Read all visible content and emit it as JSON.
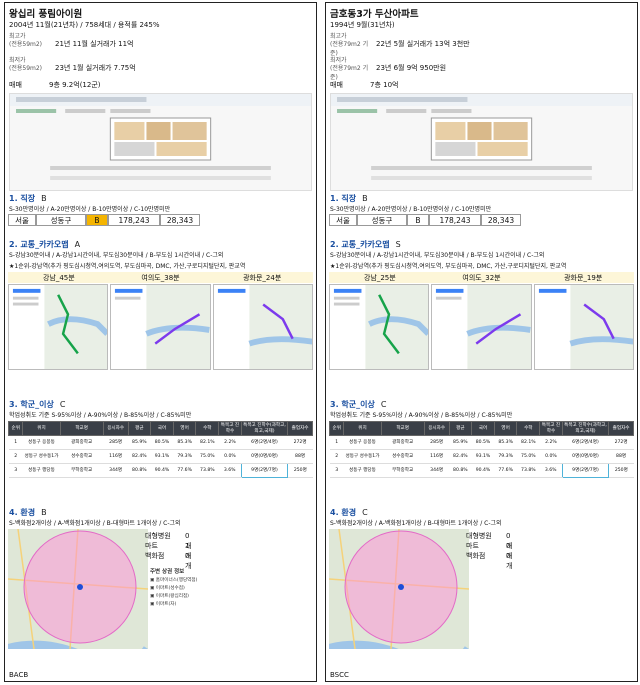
{
  "panels": [
    {
      "name": "왕십리 풍림아이원",
      "built": "2004년 11월(21년차) / 758세대 / 용적률 245%",
      "max_price_label": "최고가",
      "max_price_type": "(전용59m2)",
      "max_price": "21년 11월 실거래가 11억",
      "min_price_label": "최저가",
      "min_price_type": "(전용59m2)",
      "min_price": "23년 1월 실거래가 7.75억",
      "sale_label": "매매",
      "sale_value": "9층 9.2억(12군)",
      "job": {
        "heading": "1. 직장",
        "grade": "B",
        "criteria": "S-30만명이상 / A-20만명이상 / B-10만명이상 / C-10만명미만",
        "city": "서울",
        "district": "성동구",
        "district_grade": "B",
        "v1": "178,243",
        "v2": "28,343"
      },
      "transport": {
        "heading": "2. 교통_카카오맵",
        "grade": "A",
        "criteria": "S-강남30분이내 / A-강남1시간이내, 부도심30분이내 / B-부도심 1시간이내 / C-그외",
        "note": "★1순위-강남역(추가 핑도심시청역,여의도역, 부도심마곡, DMC, 가산,구로디지털단지, 판교역",
        "routes": [
          "강남_45분",
          "여의도_38분",
          "광화문_24분"
        ]
      },
      "school": {
        "heading": "3. 학군_이상",
        "grade": "C",
        "criteria": "학업성취도 기준 S-95%이상 / A-90%이상 / B-85%이상 / C-85%미만",
        "headers": [
          "순위",
          "위치",
          "학교명",
          "응시자수",
          "평균",
          "국어",
          "영어",
          "수학",
          "특목고 진학수",
          "특목고 진학수(과학고,외고,국제)",
          "졸업자수"
        ],
        "rows": [
          [
            "1",
            "성동구 응봉동",
            "광희중학교",
            "285명",
            "85.9%",
            "80.5%",
            "85.3%",
            "82.1%",
            "2.2%",
            "6명(2명/4명)",
            "272명"
          ],
          [
            "2",
            "성동구 성수동1가",
            "성수중학교",
            "116명",
            "82.4%",
            "93.1%",
            "79.3%",
            "75.0%",
            "0.0%",
            "0명(0명/0명)",
            "88명"
          ],
          [
            "3",
            "성동구 행당동",
            "무학중학교",
            "344명",
            "80.8%",
            "90.4%",
            "77.6%",
            "73.8%",
            "3.6%",
            "9명(2명/7명)",
            "250명"
          ]
        ]
      },
      "env": {
        "heading": "4. 환경",
        "grade": "B",
        "criteria": "S-백화점2개이상 / A-백화점1개이상 / B-대형마트 1개이상 / C-그외",
        "facilities": [
          {
            "label": "대형병원",
            "value": "0개"
          },
          {
            "label": "마트",
            "value": "1개"
          },
          {
            "label": "백화점",
            "value": "0개"
          }
        ],
        "legend_title": "주변 상권 정보",
        "legend": [
          "홈마이너스(행당역점)",
          "이마트(성수점)",
          "이마트(왕십리점)",
          "이마트(자)"
        ]
      },
      "code": "BACB"
    },
    {
      "name": "금호동3가 두산아파트",
      "built": "1994년 9월(31년차)",
      "max_price_label": "최고가",
      "max_price_type": "(전용79m2 기준)",
      "max_price": "22년 5월 실거래가 13억 3천만",
      "min_price_label": "최저가",
      "min_price_type": "(전용79m2 기준)",
      "min_price": "23년 6월 9억 950만원",
      "sale_label": "매매",
      "sale_value": "7층 10억",
      "job": {
        "heading": "1. 직장",
        "grade": "B",
        "criteria": "S-30만명이상 / A-20만명이상 / B-10만명이상 / C-10만명미만",
        "city": "서울",
        "district": "성동구",
        "district_grade": "B",
        "v1": "178,243",
        "v2": "28,343"
      },
      "transport": {
        "heading": "2. 교통_카카오맵",
        "grade": "S",
        "criteria": "S-강남30분이내 / A-강남1시간이내, 부도심30분이내 / B-부도심 1시간이내 / C-그외",
        "note": "★1순위-강남역(추가 핑도심시청역,여의도역, 부도심마곡, DMC, 가산,구로디지털단지, 판교역",
        "routes": [
          "강남_25분",
          "여의도_32분",
          "광화문_19분"
        ]
      },
      "school": {
        "heading": "3. 학군_이상",
        "grade": "C",
        "criteria": "학업성취도 기준 S-95%이상 / A-90%이상 / B-85%이상 / C-85%미만",
        "headers": [
          "순위",
          "위치",
          "학교명",
          "응시자수",
          "평균",
          "국어",
          "영어",
          "수학",
          "특목고 진학수",
          "특목고 진학수(과학고,외고,국제)",
          "졸업자수"
        ],
        "rows": [
          [
            "1",
            "성동구 응봉동",
            "광희중학교",
            "285명",
            "85.9%",
            "80.5%",
            "85.3%",
            "82.1%",
            "2.2%",
            "6명(2명/4명)",
            "272명"
          ],
          [
            "2",
            "성동구 성수동1가",
            "성수중학교",
            "116명",
            "82.4%",
            "93.1%",
            "79.3%",
            "75.0%",
            "0.0%",
            "0명(0명/0명)",
            "88명"
          ],
          [
            "3",
            "성동구 행당동",
            "무학중학교",
            "344명",
            "80.8%",
            "90.4%",
            "77.6%",
            "73.8%",
            "3.6%",
            "9명(2명/7명)",
            "250명"
          ]
        ]
      },
      "env": {
        "heading": "4. 환경",
        "grade": "C",
        "criteria": "S-백화점2개이상 / A-백화점1개이상 / B-대형마트 1개이상 / C-그외",
        "facilities": [
          {
            "label": "대형병원",
            "value": "0개"
          },
          {
            "label": "마트",
            "value": "0개"
          },
          {
            "label": "백화점",
            "value": "0개"
          }
        ],
        "legend_title": "",
        "legend": []
      },
      "code": "BSCC"
    }
  ],
  "colors": {
    "heading_blue": "#1a4fa0",
    "grade_highlight": "#f4b400",
    "route_header_bg": "#fdf6d8",
    "school_highlight_border": "#4fb3d9",
    "env_overlay": "#ff8fd8"
  }
}
